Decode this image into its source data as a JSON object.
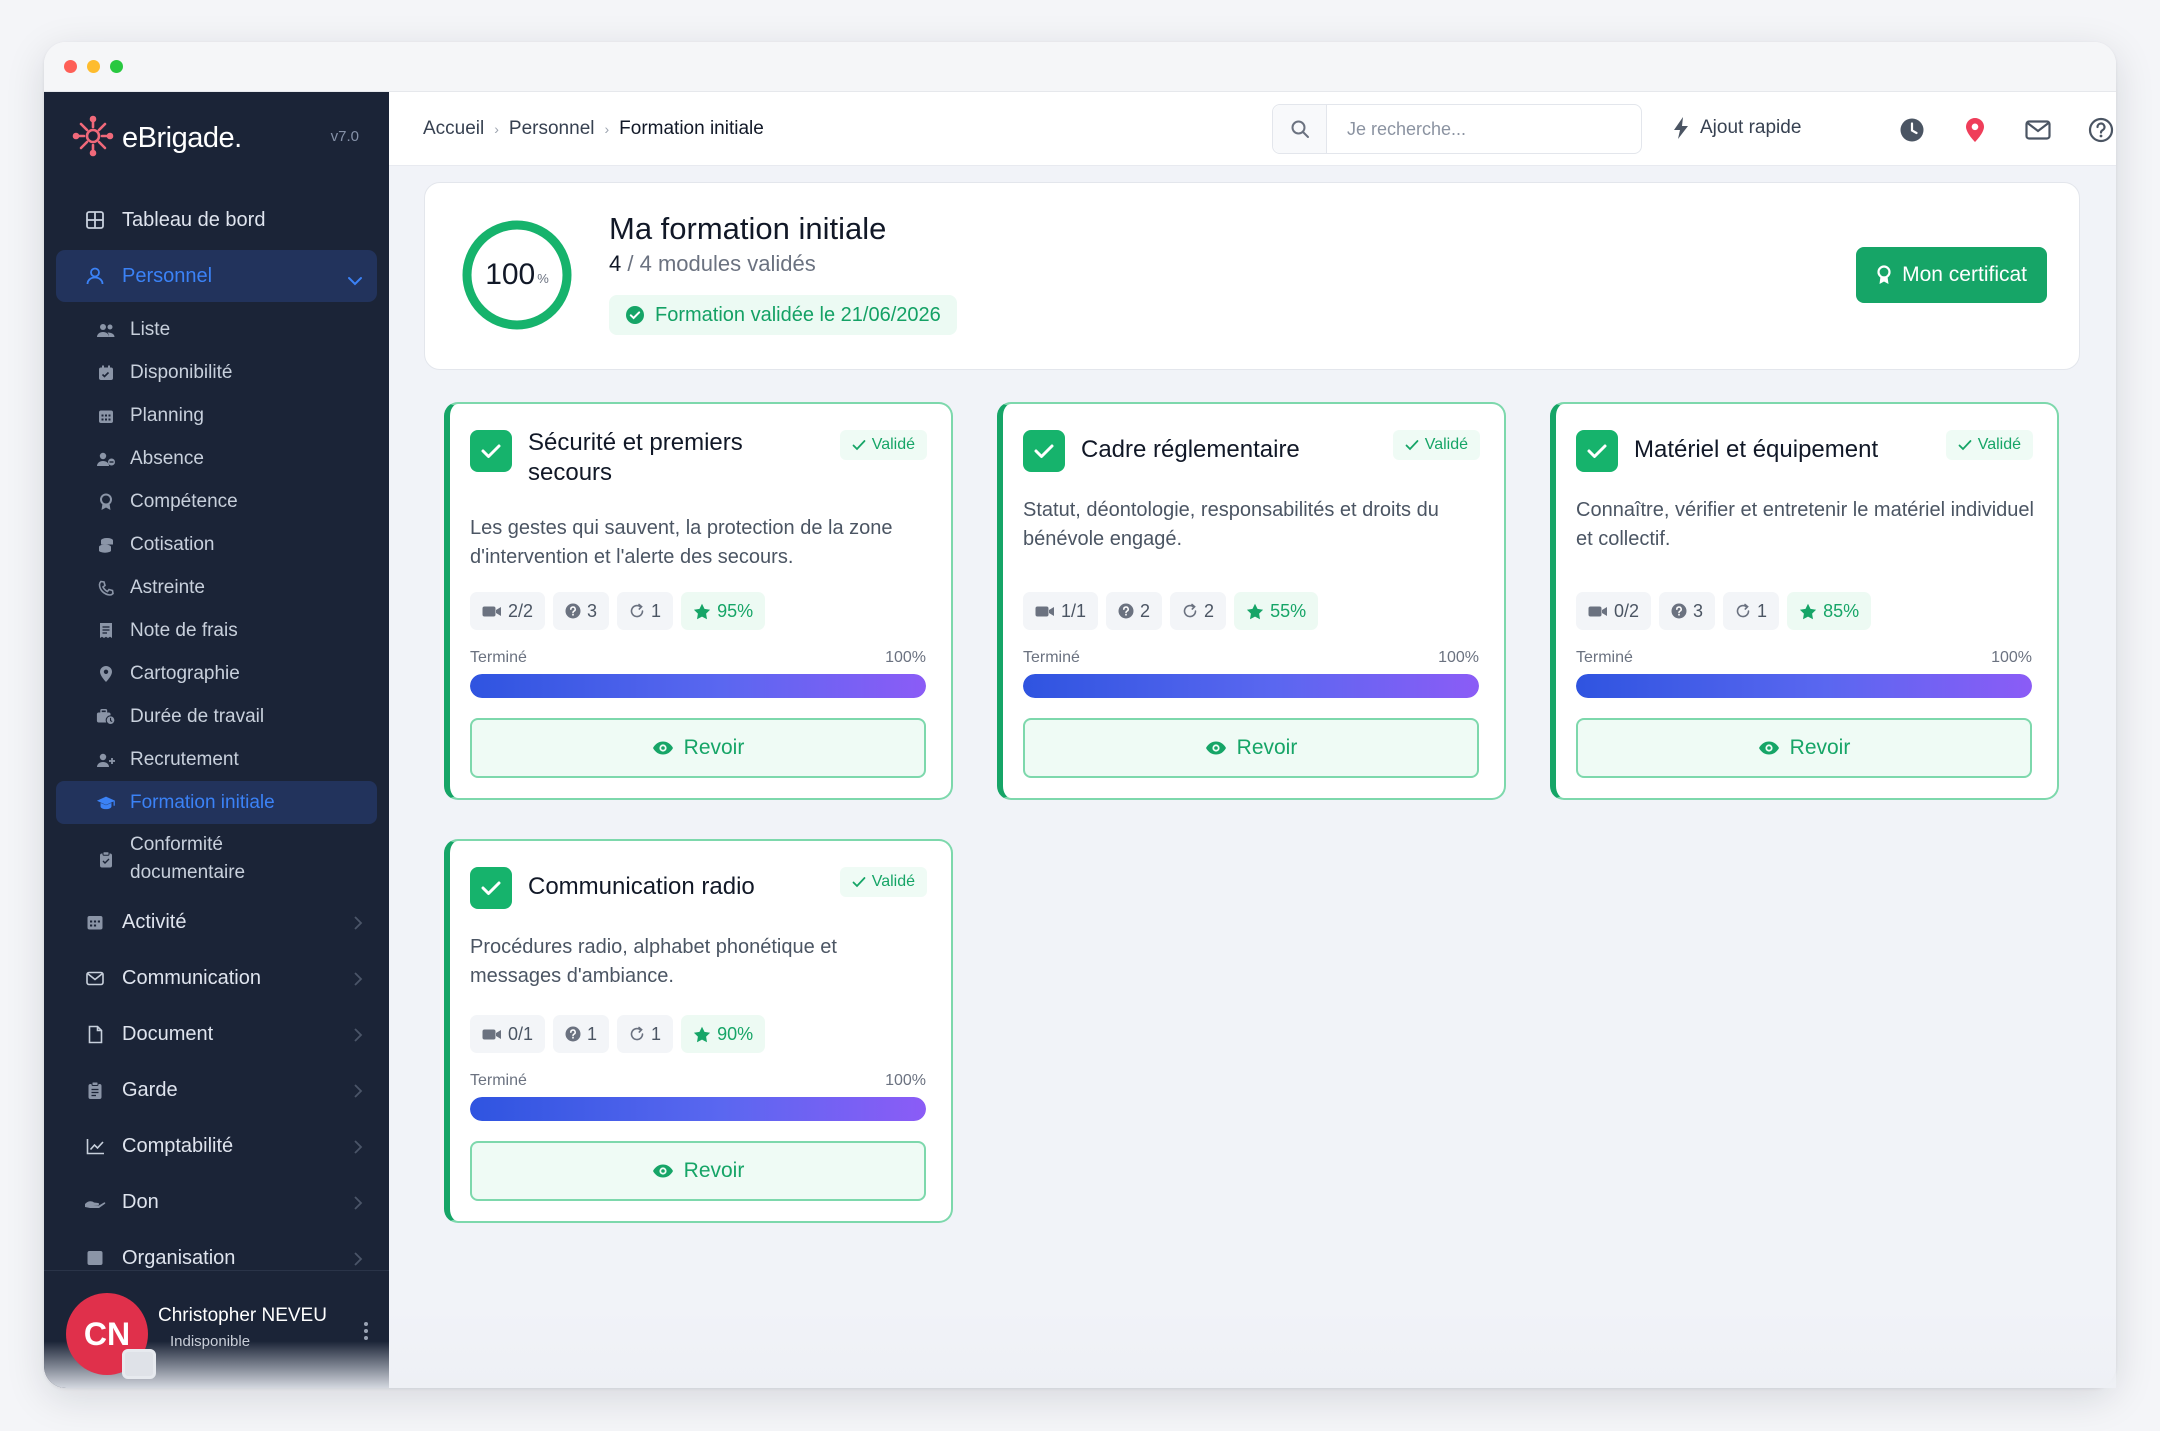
{
  "brand": {
    "name": "eBrigade.",
    "version": "v7.0"
  },
  "sidebar": {
    "top_item": {
      "label": "Tableau de bord"
    },
    "open_section": {
      "label": "Personnel"
    },
    "sub_items": [
      {
        "label": "Liste",
        "icon": "users-icon"
      },
      {
        "label": "Disponibilité",
        "icon": "calendar-check-icon"
      },
      {
        "label": "Planning",
        "icon": "calendar-grid-icon"
      },
      {
        "label": "Absence",
        "icon": "user-minus-icon"
      },
      {
        "label": "Compétence",
        "icon": "award-icon"
      },
      {
        "label": "Cotisation",
        "icon": "coins-icon"
      },
      {
        "label": "Astreinte",
        "icon": "phone-icon"
      },
      {
        "label": "Note de frais",
        "icon": "receipt-icon"
      },
      {
        "label": "Cartographie",
        "icon": "map-pin-icon"
      },
      {
        "label": "Durée de travail",
        "icon": "briefcase-clock-icon"
      },
      {
        "label": "Recrutement",
        "icon": "user-plus-icon"
      },
      {
        "label": "Formation initiale",
        "icon": "graduation-cap-icon"
      },
      {
        "label": "Conformité documentaire",
        "icon": "clipboard-icon"
      }
    ],
    "sections": [
      {
        "label": "Activité",
        "icon": "calendar-icon"
      },
      {
        "label": "Communication",
        "icon": "mail-icon"
      },
      {
        "label": "Document",
        "icon": "file-icon"
      },
      {
        "label": "Garde",
        "icon": "clipboard-list-icon"
      },
      {
        "label": "Comptabilité",
        "icon": "chart-line-icon"
      },
      {
        "label": "Don",
        "icon": "hand-heart-icon"
      },
      {
        "label": "Organisation",
        "icon": "sitemap-icon"
      }
    ],
    "user": {
      "initials": "CN",
      "name": "Christopher NEVEU",
      "status": "Indisponible"
    }
  },
  "topbar": {
    "breadcrumb": [
      "Accueil",
      "Personnel",
      "Formation initiale"
    ],
    "search_placeholder": "Je recherche...",
    "quick_add": "Ajout rapide"
  },
  "summary": {
    "percent": 100,
    "percent_value": "100",
    "percent_unit": "%",
    "title": "Ma formation initiale",
    "validated_count": "4",
    "validated_rest": "/ 4 modules validés",
    "badge": "Formation validée le 21/06/2026",
    "certificate_button": "Mon certificat"
  },
  "modules": [
    {
      "title": "Sécurité et premiers secours",
      "status": "Validé",
      "description": "Les gestes qui sauvent, la protection de la zone d'intervention et l'alerte des secours.",
      "videos": "2/2",
      "questions": "3",
      "attempts": "1",
      "score": "95%",
      "progress_label": "Terminé",
      "progress_value": "100%",
      "progress": 100,
      "button": "Revoir"
    },
    {
      "title": "Cadre réglementaire",
      "status": "Validé",
      "description": "Statut, déontologie, responsabilités et droits du bénévole engagé.",
      "videos": "1/1",
      "questions": "2",
      "attempts": "2",
      "score": "55%",
      "progress_label": "Terminé",
      "progress_value": "100%",
      "progress": 100,
      "button": "Revoir"
    },
    {
      "title": "Matériel et équipement",
      "status": "Validé",
      "description": "Connaître, vérifier et entretenir le matériel individuel et collectif.",
      "videos": "0/2",
      "questions": "3",
      "attempts": "1",
      "score": "85%",
      "progress_label": "Terminé",
      "progress_value": "100%",
      "progress": 100,
      "button": "Revoir"
    },
    {
      "title": "Communication radio",
      "status": "Validé",
      "description": "Procédures radio, alphabet phonétique et messages d'ambiance.",
      "videos": "0/1",
      "questions": "1",
      "attempts": "1",
      "score": "90%",
      "progress_label": "Terminé",
      "progress_value": "100%",
      "progress": 100,
      "button": "Revoir"
    }
  ],
  "colors": {
    "sidebar_bg": "#1b2437",
    "accent_blue": "#3b82f6",
    "success_green": "#16a567",
    "avatar_red": "#e0304b",
    "progress_start": "#2f54e0",
    "progress_end": "#8b5cf6"
  }
}
